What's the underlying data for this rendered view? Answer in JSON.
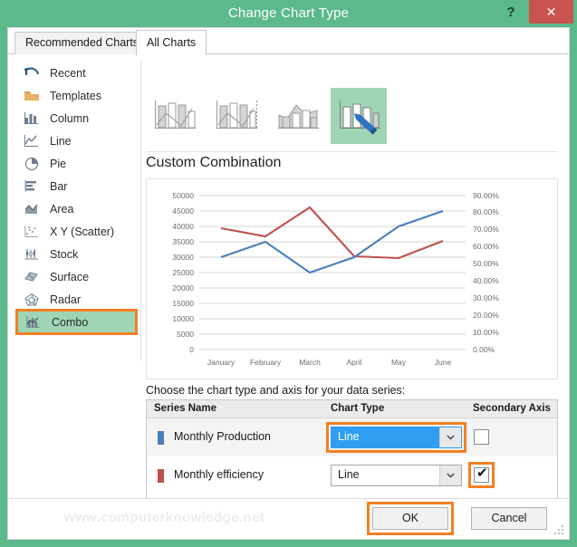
{
  "window": {
    "title": "Change Chart Type",
    "help_label": "?",
    "close_label": "✕"
  },
  "tabs": [
    {
      "label": "Recommended Charts",
      "selected": false
    },
    {
      "label": "All Charts",
      "selected": true
    }
  ],
  "sidebar": {
    "items": [
      {
        "label": "Recent",
        "icon": "recent-icon",
        "selected": false
      },
      {
        "label": "Templates",
        "icon": "folder-icon",
        "selected": false
      },
      {
        "label": "Column",
        "icon": "column-icon",
        "selected": false
      },
      {
        "label": "Line",
        "icon": "line-icon",
        "selected": false
      },
      {
        "label": "Pie",
        "icon": "pie-icon",
        "selected": false
      },
      {
        "label": "Bar",
        "icon": "bar-icon",
        "selected": false
      },
      {
        "label": "Area",
        "icon": "area-icon",
        "selected": false
      },
      {
        "label": "X Y (Scatter)",
        "icon": "scatter-icon",
        "selected": false
      },
      {
        "label": "Stock",
        "icon": "stock-icon",
        "selected": false
      },
      {
        "label": "Surface",
        "icon": "surface-icon",
        "selected": false
      },
      {
        "label": "Radar",
        "icon": "radar-icon",
        "selected": false
      },
      {
        "label": "Combo",
        "icon": "combo-icon",
        "selected": true
      }
    ]
  },
  "gallery": {
    "thumbnails": [
      {
        "name": "clustered-column-line-thumb",
        "selected": false
      },
      {
        "name": "clustered-column-line-secondary-axis-thumb",
        "selected": false
      },
      {
        "name": "stacked-area-clustered-column-thumb",
        "selected": false
      },
      {
        "name": "custom-combination-thumb",
        "selected": true
      }
    ]
  },
  "preview": {
    "title": "Custom Combination"
  },
  "chart_data": {
    "type": "line",
    "title": "Custom Combination",
    "categories": [
      "January",
      "February",
      "March",
      "April",
      "May",
      "June"
    ],
    "series": [
      {
        "name": "Monthly Production",
        "color": "#4a7ebb",
        "axis": "primary",
        "values": [
          30000,
          35000,
          25000,
          30000,
          40000,
          45000
        ]
      },
      {
        "name": "Monthly efficiency",
        "color": "#c0504d",
        "axis": "secondary",
        "values": [
          73.0,
          69.0,
          84.0,
          62.0,
          61.0,
          71.5
        ]
      }
    ],
    "yaxis_primary": {
      "min": 0,
      "max": 50000,
      "ticks": [
        "50000",
        "45000",
        "40000",
        "35000",
        "30000",
        "25000",
        "20000",
        "15000",
        "10000",
        "5000",
        "0"
      ]
    },
    "yaxis_secondary": {
      "min": 0,
      "max": 90,
      "ticks": [
        "90.00%",
        "80.00%",
        "70.00%",
        "60.00%",
        "50.00%",
        "40.00%",
        "30.00%",
        "20.00%",
        "10.00%",
        "0.00%"
      ]
    },
    "xlabel": "",
    "ylabel": "",
    "grid": true,
    "legend": false
  },
  "series_section": {
    "instruction": "Choose the chart type and axis for your data series:",
    "columns": [
      "Series Name",
      "Chart Type",
      "Secondary Axis"
    ],
    "rows": [
      {
        "name": "Monthly Production",
        "swatch_color": "#4a7ebb",
        "chart_type": "Line",
        "chart_type_highlighted": true,
        "secondary_axis": false,
        "secondary_axis_highlighted": false
      },
      {
        "name": "Monthly efficiency",
        "swatch_color": "#c0504d",
        "chart_type": "Line",
        "chart_type_highlighted": false,
        "secondary_axis": true,
        "secondary_axis_highlighted": true
      }
    ]
  },
  "footer": {
    "watermark": "www.computerknowledge.net",
    "ok_label": "OK",
    "cancel_label": "Cancel"
  },
  "colors": {
    "titlebar": "#5cb98b",
    "close": "#c9534f",
    "highlight_orange": "#f28022",
    "selection_green": "#9fd5b5",
    "dropdown_blue": "#2f9ef0"
  }
}
